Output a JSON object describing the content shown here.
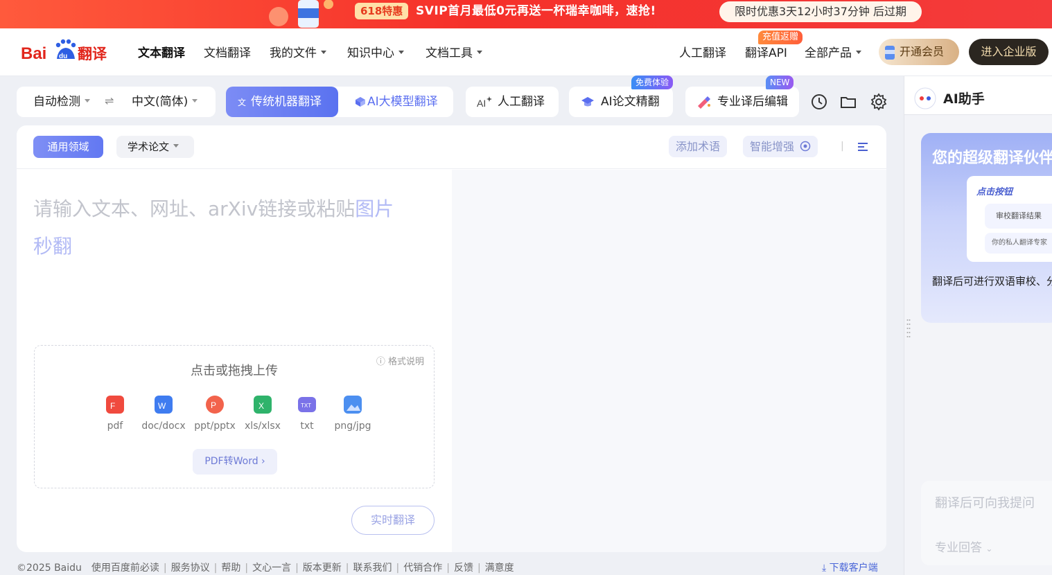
{
  "promo": {
    "tag": "618特惠",
    "text": "SVIP首月最低0元再送一杯瑞幸咖啡，速抢!",
    "countdown": "限时优惠3天12小时37分钟 后过期"
  },
  "nav": {
    "logo_text": "Baidu翻译",
    "items": [
      {
        "label": "文本翻译"
      },
      {
        "label": "文档翻译"
      },
      {
        "label": "我的文件"
      },
      {
        "label": "知识中心"
      },
      {
        "label": "文档工具"
      }
    ],
    "right_items": [
      {
        "label": "人工翻译"
      },
      {
        "label": "翻译API"
      },
      {
        "label": "全部产品"
      }
    ],
    "charge_badge": "充值返赠",
    "vip_button": "开通会员",
    "enterprise_button": "进入企业版"
  },
  "toolbar": {
    "source_lang": "自动检测",
    "target_lang": "中文(简体)",
    "mode_traditional": "传统机器翻译",
    "mode_ai": "AI大模型翻译",
    "human_translate": "人工翻译",
    "paper_translate": "AI论文精翻",
    "paper_badge": "免费体验",
    "post_edit": "专业译后编辑",
    "post_edit_badge": "NEW"
  },
  "panel": {
    "domain_general": "通用领域",
    "domain_academic": "学术论文",
    "add_term": "添加术语",
    "smart_enhance": "智能增强",
    "placeholder_main": "请输入文本、网址、arXiv链接或粘贴",
    "placeholder_highlight": "图片",
    "placeholder_end": "秒翻",
    "upload_title": "点击或拖拽上传",
    "format_help": "格式说明",
    "file_types": [
      {
        "label": "pdf",
        "color": "#f04a3e"
      },
      {
        "label": "doc/docx",
        "color": "#3f7cf0"
      },
      {
        "label": "ppt/pptx",
        "color": "#f2634c"
      },
      {
        "label": "xls/xlsx",
        "color": "#2fb36b"
      },
      {
        "label": "txt",
        "color": "#7a72e8"
      },
      {
        "label": "png/jpg",
        "color": "#4c8ff0"
      }
    ],
    "pdf_to_word": "PDF转Word",
    "realtime_translate": "实时翻译"
  },
  "footer": {
    "links": [
      "©2025 Baidu",
      "使用百度前必读",
      "服务协议",
      "帮助",
      "文心一言",
      "版本更新",
      "联系我们",
      "代销合作",
      "反馈",
      "满意度"
    ],
    "download": "下载客户端"
  },
  "ai_assistant": {
    "title": "AI助手",
    "headline": "您的超级翻译伙伴",
    "illus_label_1": "点击按钮",
    "illus_label_2": "审校翻译结果",
    "illus_label_3": "你的私人翻译专家",
    "description": "翻译后可进行双语审校、分析",
    "input_placeholder": "翻译后可向我提问",
    "answer_mode": "专业回答"
  },
  "colors": {
    "accent": "#5a72f0",
    "promo_red": "#f5302a",
    "enterprise_dark": "#2b2620"
  }
}
